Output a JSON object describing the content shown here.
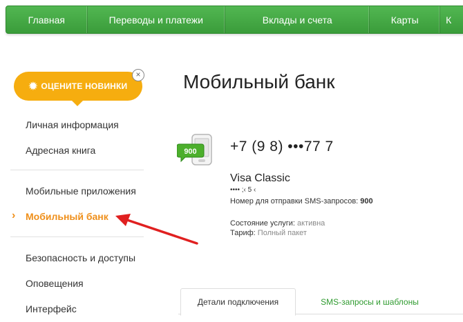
{
  "topnav": {
    "items": [
      "Главная",
      "Переводы и платежи",
      "Вклады и счета",
      "Карты",
      "К"
    ]
  },
  "promo": {
    "label": "ОЦЕНИТЕ НОВИНКИ",
    "close": "×"
  },
  "sidebar": {
    "items": [
      "Личная информация",
      "Адресная книга",
      "Мобильные приложения",
      "Мобильный банк",
      "Безопасность и доступы",
      "Оповещения",
      "Интерфейс"
    ],
    "active": "Мобильный банк"
  },
  "main": {
    "title": "Мобильный банк",
    "icon_badge": "900",
    "phone": "+7 (9  8) •••77  7",
    "card_name": "Visa Classic",
    "card_mask": "•••• ;‹ 5 ‹",
    "sms_number_label": "Номер для отправки SMS-запросов:",
    "sms_number": "900",
    "status_label": "Состояние услуги:",
    "status_value": "активна",
    "tariff_label": "Тариф:",
    "tariff_value": "Полный пакет"
  },
  "tabs": [
    "Детали подключения",
    "SMS-запросы и шаблоны"
  ],
  "colors": {
    "nav_green": "#3fa63f",
    "promo_orange": "#f6ad0f",
    "active_orange": "#ef8f1a",
    "arrow_red": "#e02020"
  }
}
